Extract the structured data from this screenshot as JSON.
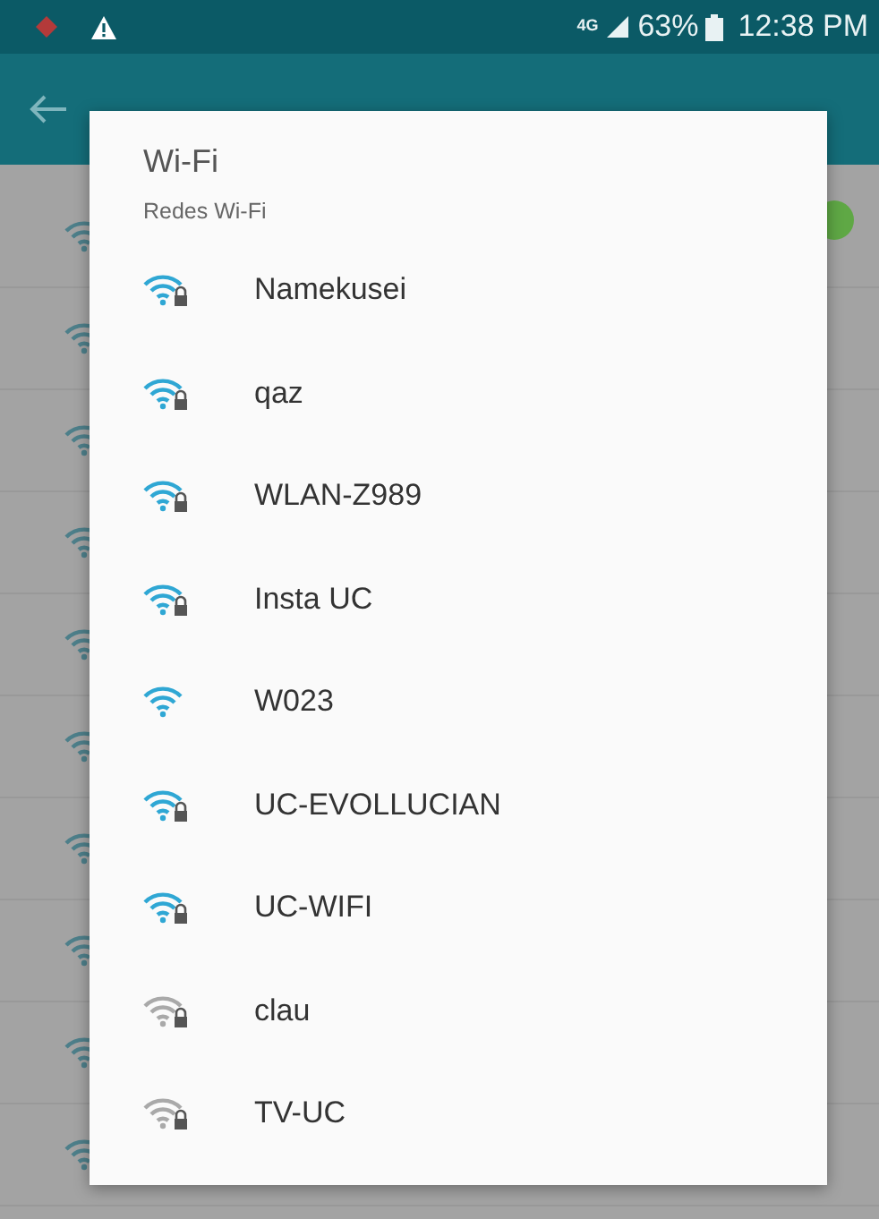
{
  "status_bar": {
    "network": "4G",
    "battery": "63%",
    "time": "12:38 PM"
  },
  "wifi_switch": {
    "on": true
  },
  "dialog": {
    "title": "Wi-Fi",
    "subtitle": "Redes Wi-Fi",
    "networks": [
      {
        "name": "Namekusei",
        "secured": true,
        "weak_signal": false
      },
      {
        "name": "qaz",
        "secured": true,
        "weak_signal": false
      },
      {
        "name": "WLAN-Z989",
        "secured": true,
        "weak_signal": false
      },
      {
        "name": "Insta UC",
        "secured": true,
        "weak_signal": false
      },
      {
        "name": "W023",
        "secured": false,
        "weak_signal": false
      },
      {
        "name": "UC-EVOLLUCIAN",
        "secured": true,
        "weak_signal": false
      },
      {
        "name": "UC-WIFI",
        "secured": true,
        "weak_signal": false
      },
      {
        "name": "clau",
        "secured": true,
        "weak_signal": true
      },
      {
        "name": "TV-UC",
        "secured": true,
        "weak_signal": true
      }
    ]
  }
}
